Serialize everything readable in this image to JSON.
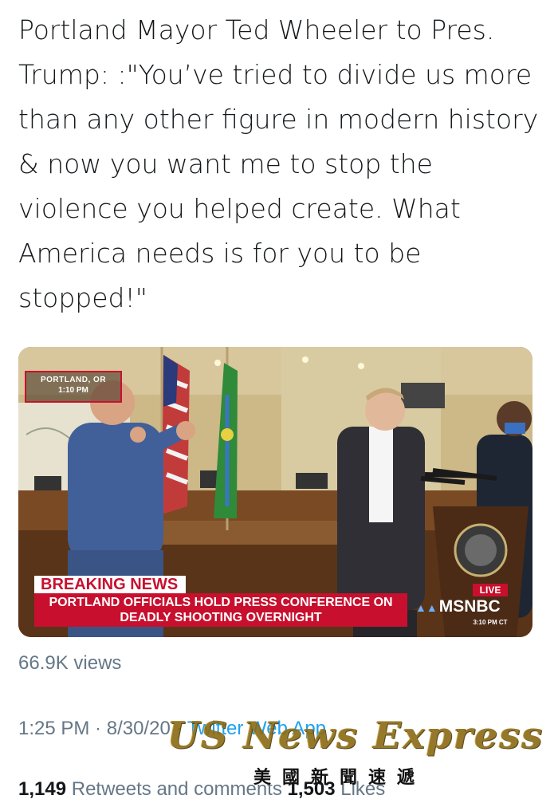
{
  "tweet": {
    "text": "Portland Mayor Ted Wheeler to Pres. Trump: :\"You’ve tried to divide us more than any other figure in modern history & now you want me to stop the violence you helped create. What America needs is for you to be stopped!\""
  },
  "video": {
    "location": "PORTLAND, OR",
    "location_time": "1:10 PM",
    "breaking_label": "BREAKING NEWS",
    "headline_line1": "PORTLAND OFFICIALS HOLD PRESS CONFERENCE ON",
    "headline_line2": "DEADLY SHOOTING OVERNIGHT",
    "live_label": "LIVE",
    "network": "MSNBC",
    "network_time": "3:10 PM CT"
  },
  "views": "66.9K views",
  "meta": {
    "time": "1:25 PM",
    "separator1": " · ",
    "date": "8/30/20",
    "separator2": " · ",
    "client": "Twitter Web App"
  },
  "stats": {
    "retweets_count": "1,149",
    "retweets_label": " Retweets and comments ",
    "likes_count": "1,503",
    "likes_label": " Likes"
  },
  "watermark": {
    "title": "US News Express",
    "subtitle": "美國新聞速遞"
  },
  "colors": {
    "breaking_red": "#c8102e",
    "link_blue": "#1da1f2",
    "muted_gray": "#657786",
    "watermark_gold": "#8a6a14"
  }
}
